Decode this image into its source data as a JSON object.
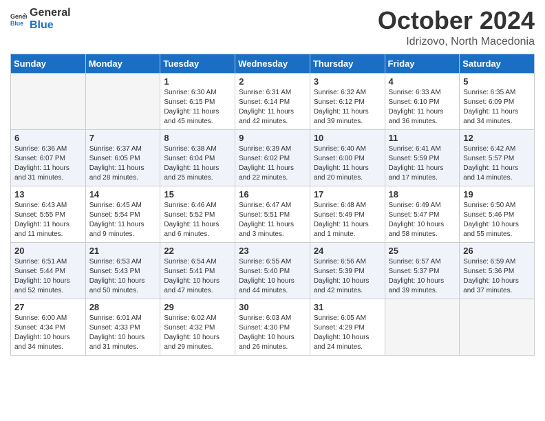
{
  "logo": {
    "general": "General",
    "blue": "Blue"
  },
  "title": "October 2024",
  "location": "Idrizovo, North Macedonia",
  "weekdays": [
    "Sunday",
    "Monday",
    "Tuesday",
    "Wednesday",
    "Thursday",
    "Friday",
    "Saturday"
  ],
  "weeks": [
    [
      {
        "day": "",
        "info": ""
      },
      {
        "day": "",
        "info": ""
      },
      {
        "day": "1",
        "info": "Sunrise: 6:30 AM\nSunset: 6:15 PM\nDaylight: 11 hours and 45 minutes."
      },
      {
        "day": "2",
        "info": "Sunrise: 6:31 AM\nSunset: 6:14 PM\nDaylight: 11 hours and 42 minutes."
      },
      {
        "day": "3",
        "info": "Sunrise: 6:32 AM\nSunset: 6:12 PM\nDaylight: 11 hours and 39 minutes."
      },
      {
        "day": "4",
        "info": "Sunrise: 6:33 AM\nSunset: 6:10 PM\nDaylight: 11 hours and 36 minutes."
      },
      {
        "day": "5",
        "info": "Sunrise: 6:35 AM\nSunset: 6:09 PM\nDaylight: 11 hours and 34 minutes."
      }
    ],
    [
      {
        "day": "6",
        "info": "Sunrise: 6:36 AM\nSunset: 6:07 PM\nDaylight: 11 hours and 31 minutes."
      },
      {
        "day": "7",
        "info": "Sunrise: 6:37 AM\nSunset: 6:05 PM\nDaylight: 11 hours and 28 minutes."
      },
      {
        "day": "8",
        "info": "Sunrise: 6:38 AM\nSunset: 6:04 PM\nDaylight: 11 hours and 25 minutes."
      },
      {
        "day": "9",
        "info": "Sunrise: 6:39 AM\nSunset: 6:02 PM\nDaylight: 11 hours and 22 minutes."
      },
      {
        "day": "10",
        "info": "Sunrise: 6:40 AM\nSunset: 6:00 PM\nDaylight: 11 hours and 20 minutes."
      },
      {
        "day": "11",
        "info": "Sunrise: 6:41 AM\nSunset: 5:59 PM\nDaylight: 11 hours and 17 minutes."
      },
      {
        "day": "12",
        "info": "Sunrise: 6:42 AM\nSunset: 5:57 PM\nDaylight: 11 hours and 14 minutes."
      }
    ],
    [
      {
        "day": "13",
        "info": "Sunrise: 6:43 AM\nSunset: 5:55 PM\nDaylight: 11 hours and 11 minutes."
      },
      {
        "day": "14",
        "info": "Sunrise: 6:45 AM\nSunset: 5:54 PM\nDaylight: 11 hours and 9 minutes."
      },
      {
        "day": "15",
        "info": "Sunrise: 6:46 AM\nSunset: 5:52 PM\nDaylight: 11 hours and 6 minutes."
      },
      {
        "day": "16",
        "info": "Sunrise: 6:47 AM\nSunset: 5:51 PM\nDaylight: 11 hours and 3 minutes."
      },
      {
        "day": "17",
        "info": "Sunrise: 6:48 AM\nSunset: 5:49 PM\nDaylight: 11 hours and 1 minute."
      },
      {
        "day": "18",
        "info": "Sunrise: 6:49 AM\nSunset: 5:47 PM\nDaylight: 10 hours and 58 minutes."
      },
      {
        "day": "19",
        "info": "Sunrise: 6:50 AM\nSunset: 5:46 PM\nDaylight: 10 hours and 55 minutes."
      }
    ],
    [
      {
        "day": "20",
        "info": "Sunrise: 6:51 AM\nSunset: 5:44 PM\nDaylight: 10 hours and 52 minutes."
      },
      {
        "day": "21",
        "info": "Sunrise: 6:53 AM\nSunset: 5:43 PM\nDaylight: 10 hours and 50 minutes."
      },
      {
        "day": "22",
        "info": "Sunrise: 6:54 AM\nSunset: 5:41 PM\nDaylight: 10 hours and 47 minutes."
      },
      {
        "day": "23",
        "info": "Sunrise: 6:55 AM\nSunset: 5:40 PM\nDaylight: 10 hours and 44 minutes."
      },
      {
        "day": "24",
        "info": "Sunrise: 6:56 AM\nSunset: 5:39 PM\nDaylight: 10 hours and 42 minutes."
      },
      {
        "day": "25",
        "info": "Sunrise: 6:57 AM\nSunset: 5:37 PM\nDaylight: 10 hours and 39 minutes."
      },
      {
        "day": "26",
        "info": "Sunrise: 6:59 AM\nSunset: 5:36 PM\nDaylight: 10 hours and 37 minutes."
      }
    ],
    [
      {
        "day": "27",
        "info": "Sunrise: 6:00 AM\nSunset: 4:34 PM\nDaylight: 10 hours and 34 minutes."
      },
      {
        "day": "28",
        "info": "Sunrise: 6:01 AM\nSunset: 4:33 PM\nDaylight: 10 hours and 31 minutes."
      },
      {
        "day": "29",
        "info": "Sunrise: 6:02 AM\nSunset: 4:32 PM\nDaylight: 10 hours and 29 minutes."
      },
      {
        "day": "30",
        "info": "Sunrise: 6:03 AM\nSunset: 4:30 PM\nDaylight: 10 hours and 26 minutes."
      },
      {
        "day": "31",
        "info": "Sunrise: 6:05 AM\nSunset: 4:29 PM\nDaylight: 10 hours and 24 minutes."
      },
      {
        "day": "",
        "info": ""
      },
      {
        "day": "",
        "info": ""
      }
    ]
  ]
}
